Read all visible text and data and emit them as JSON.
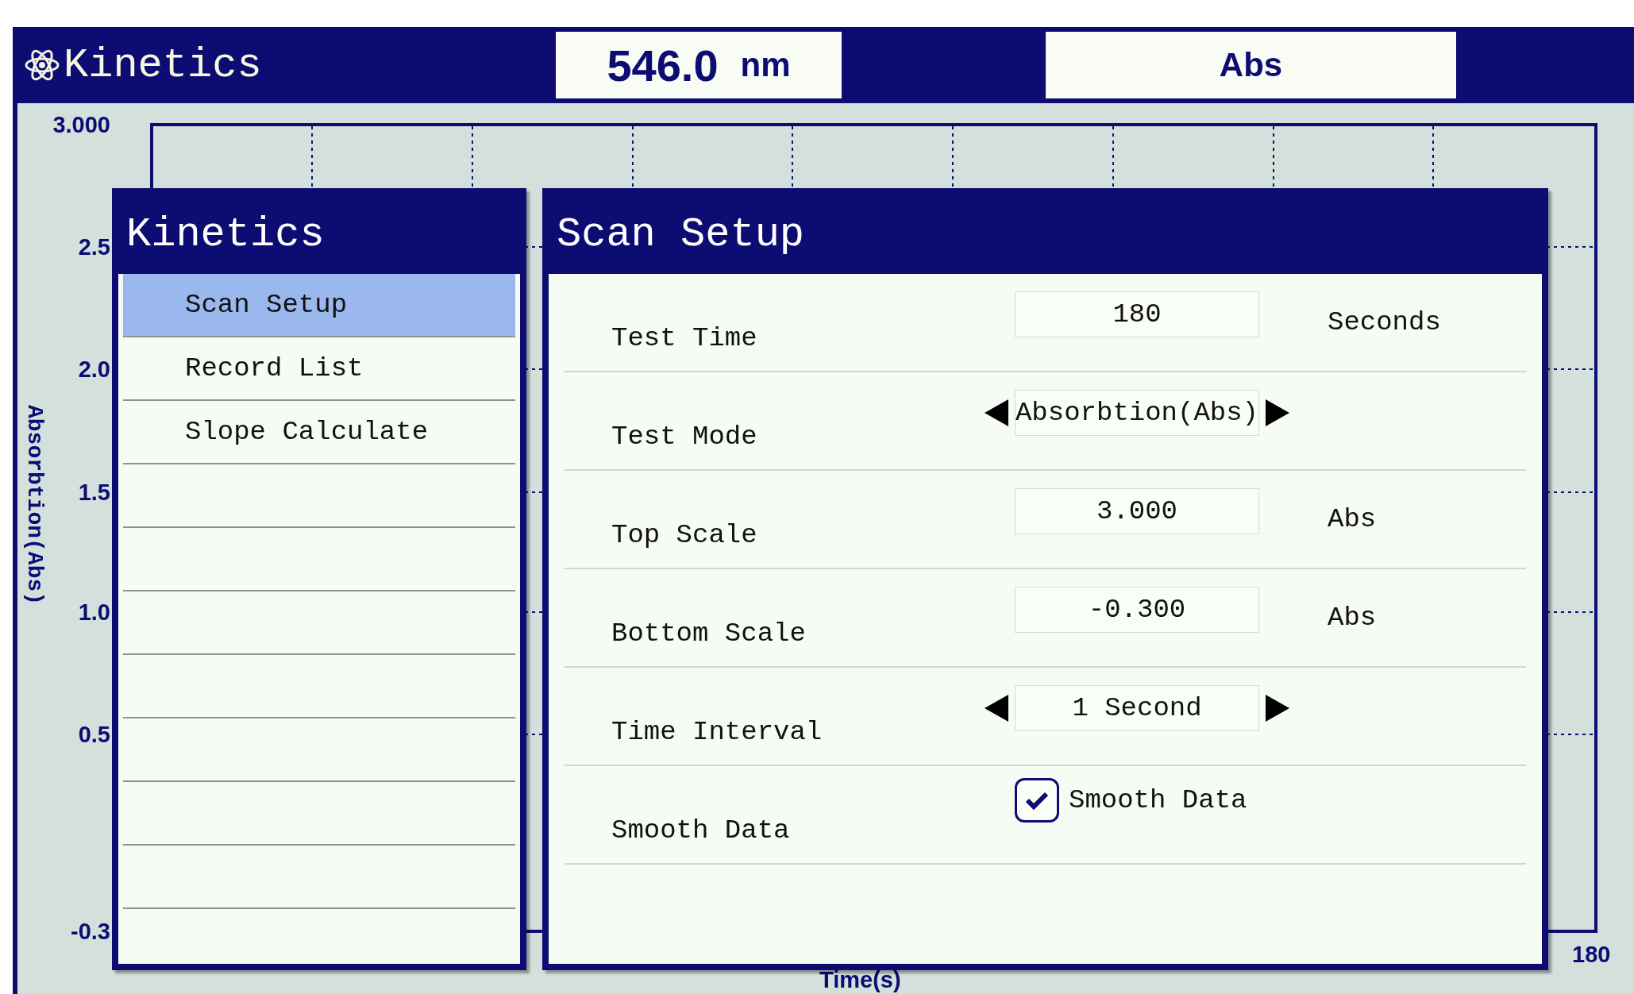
{
  "header": {
    "title": "Kinetics",
    "wavelength": "546.0",
    "wavelength_unit": "nm",
    "mode": "Abs"
  },
  "plot": {
    "y_label": "Absorbtion(Abs)",
    "x_label": "Time(s)",
    "y_tick_labels": [
      "3.000",
      "2.5",
      "2.0",
      "1.5",
      "1.0",
      "0.5",
      "-0.3"
    ],
    "x_end_label": "180"
  },
  "menu": {
    "title": "Kinetics",
    "items": [
      {
        "label": "Scan Setup",
        "selected": true
      },
      {
        "label": "Record List",
        "selected": false
      },
      {
        "label": "Slope Calculate",
        "selected": false
      }
    ]
  },
  "setup": {
    "title": "Scan Setup",
    "rows": [
      {
        "kind": "field",
        "label": "Test Time",
        "value": "180",
        "unit": "Seconds"
      },
      {
        "kind": "selector",
        "label": "Test Mode",
        "value": "Absorbtion(Abs)"
      },
      {
        "kind": "field",
        "label": "Top Scale",
        "value": "3.000",
        "unit": "Abs"
      },
      {
        "kind": "field",
        "label": "Bottom Scale",
        "value": "-0.300",
        "unit": "Abs"
      },
      {
        "kind": "selector",
        "label": "Time Interval",
        "value": "1 Second"
      },
      {
        "kind": "checkbox",
        "label": "Smooth Data",
        "option": "Smooth Data",
        "checked": true
      }
    ]
  }
}
